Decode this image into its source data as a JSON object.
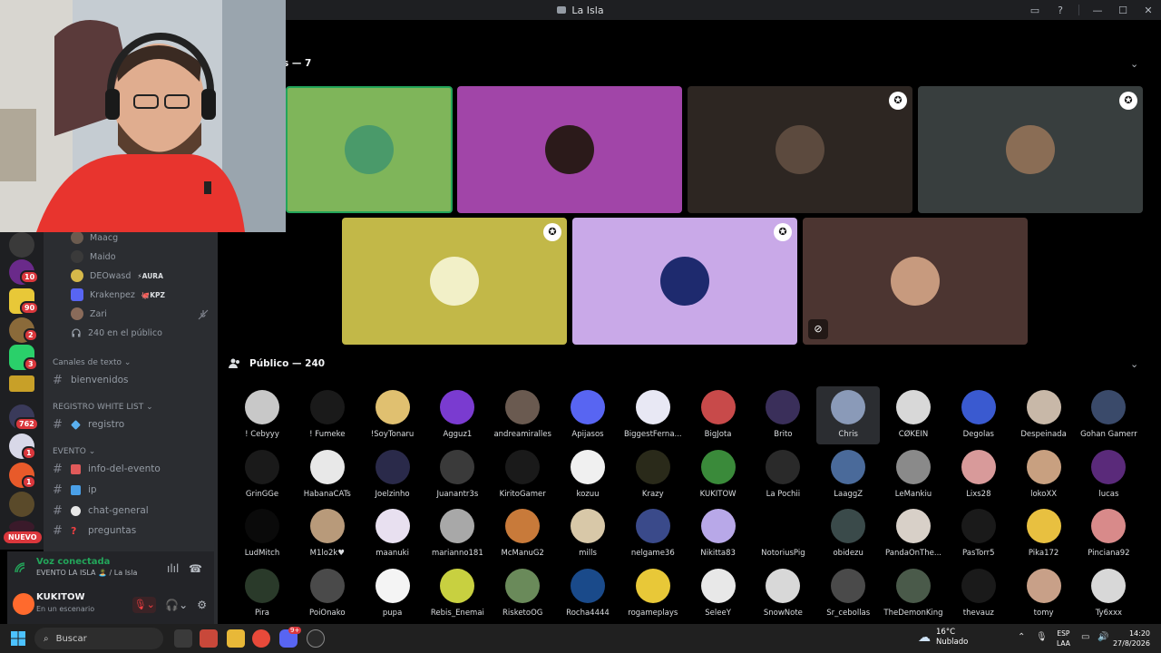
{
  "window": {
    "title": "La Isla",
    "buttons": [
      "▭",
      "?",
      "—",
      "☐",
      "✕"
    ]
  },
  "rail": {
    "badges": [
      "10",
      "90",
      "2",
      "3",
      "762",
      "1",
      "1"
    ],
    "new_label": "NUEVO"
  },
  "sidebar": {
    "voice_members": [
      {
        "name": "Maacg",
        "tag": "",
        "color": "#6b5b4f"
      },
      {
        "name": "Maido",
        "tag": "",
        "color": "#3a3a3a"
      },
      {
        "name": "DEOwasd",
        "tag": "⚡AURA",
        "color": "#d6b94a"
      },
      {
        "name": "Krakenpez",
        "tag": "🐙KPZ",
        "color": "#5865f2"
      },
      {
        "name": "Zari",
        "tag": "",
        "color": "#8a6b5a"
      }
    ],
    "audience_count": "240 en el público",
    "categories": {
      "text": "Canales de texto ⌄",
      "registro": "REGISTRO WHITE LIST ⌄",
      "evento": "EVENTO ⌄"
    },
    "channels": {
      "bienvenidos": "bienvenidos",
      "registro": "registro",
      "info": "info-del-evento",
      "ip": "ip",
      "chat": "chat-general",
      "preguntas": "preguntas"
    }
  },
  "voice_panel": {
    "status": "Voz conectada",
    "location": "EVENTO LA ISLA 🏝️ / La Isla",
    "username": "KUKITOW",
    "user_status": "En un escenario"
  },
  "stage": {
    "speakers_title": "s — 7",
    "audience_title": "Público — 240",
    "tiles": [
      {
        "bg": "#7fb55a",
        "av": "#4a9a6a",
        "star": false,
        "muted": false
      },
      {
        "bg": "#a145a8",
        "av": "#2b1a1a",
        "star": false,
        "muted": false
      },
      {
        "bg": "#2d2622",
        "av": "#5c4a3e",
        "star": true,
        "muted": false
      },
      {
        "bg": "#383e3e",
        "av": "#8a6d55",
        "star": true,
        "muted": false
      },
      {
        "bg": "#c2b848",
        "av": "#f2f0c8",
        "star": true,
        "muted": false
      },
      {
        "bg": "#c9a9e8",
        "av": "#1e2a6e",
        "star": true,
        "muted": false
      },
      {
        "bg": "#4c3531",
        "av": "#c79a7e",
        "star": false,
        "muted": true
      }
    ],
    "audience": [
      {
        "name": "! Cebyyy",
        "color": "#c8c8c8"
      },
      {
        "name": "! Fumeke",
        "color": "#1a1a1a"
      },
      {
        "name": "!SoyTonaru",
        "color": "#e0c070"
      },
      {
        "name": "Agguz1",
        "color": "#7a3bd0"
      },
      {
        "name": "andreamiralles",
        "color": "#6a5a50"
      },
      {
        "name": "Apijasos",
        "color": "#5865f2"
      },
      {
        "name": "BiggestFerna...",
        "color": "#e8e8f4"
      },
      {
        "name": "BigJota",
        "color": "#c84a4a"
      },
      {
        "name": "Brito",
        "color": "#3a2f5a"
      },
      {
        "name": "Chris",
        "color": "#8a9ab8"
      },
      {
        "name": "CØKEIN",
        "color": "#d8d8d8"
      },
      {
        "name": "Degolas",
        "color": "#3a5ad0"
      },
      {
        "name": "Despeinada",
        "color": "#c8b8a8"
      },
      {
        "name": "Gohan Gamerr",
        "color": "#3a4a6a"
      },
      {
        "name": "GrinGGe",
        "color": "#1a1a1a"
      },
      {
        "name": "HabanaCATs",
        "color": "#e8e8e8"
      },
      {
        "name": "Joelzinho",
        "color": "#2a2a4a"
      },
      {
        "name": "Juanantr3s",
        "color": "#3a3a3a"
      },
      {
        "name": "KiritoGamer",
        "color": "#1a1a1a"
      },
      {
        "name": "kozuu",
        "color": "#f0f0f0"
      },
      {
        "name": "Krazy",
        "color": "#2a2a1a"
      },
      {
        "name": "KUKITOW",
        "color": "#3a8a3a"
      },
      {
        "name": "La Pochii",
        "color": "#2a2a2a"
      },
      {
        "name": "LaaggZ",
        "color": "#4a6a9a"
      },
      {
        "name": "LeMankiu",
        "color": "#8a8a8a"
      },
      {
        "name": "Lixs28",
        "color": "#d89a9a"
      },
      {
        "name": "lokoXX",
        "color": "#c8a080"
      },
      {
        "name": "lucas",
        "color": "#5a2a7a"
      },
      {
        "name": "LudMitch",
        "color": "#0a0a0a"
      },
      {
        "name": "M1lo2k♥",
        "color": "#b89a7a"
      },
      {
        "name": "maanuki",
        "color": "#e8e0f0"
      },
      {
        "name": "marianno181",
        "color": "#a8a8a8"
      },
      {
        "name": "McManuG2",
        "color": "#c87a3a"
      },
      {
        "name": "mills",
        "color": "#d8c8a8"
      },
      {
        "name": "nelgame36",
        "color": "#3a4a8a"
      },
      {
        "name": "Nikitta83",
        "color": "#b8a8e8"
      },
      {
        "name": "NotoriusPig",
        "color": "#000000"
      },
      {
        "name": "obidezu",
        "color": "#3a4a4a"
      },
      {
        "name": "PandaOnThe...",
        "color": "#d8d0c8"
      },
      {
        "name": "PasTorr5",
        "color": "#1a1a1a"
      },
      {
        "name": "Pika172",
        "color": "#e8c040"
      },
      {
        "name": "Pinciana92",
        "color": "#d88a8a"
      },
      {
        "name": "Pira",
        "color": "#2a3a2a"
      },
      {
        "name": "PoiOnako",
        "color": "#4a4a4a"
      },
      {
        "name": "pupa",
        "color": "#f4f4f4"
      },
      {
        "name": "Rebis_Enemai",
        "color": "#c8d040"
      },
      {
        "name": "RisketoOG",
        "color": "#6a8a5a"
      },
      {
        "name": "Rocha4444",
        "color": "#1a4a8a"
      },
      {
        "name": "rogameplays",
        "color": "#e8c838"
      },
      {
        "name": "SeleeY",
        "color": "#e8e8e8"
      },
      {
        "name": "SnowNote",
        "color": "#d8d8d8"
      },
      {
        "name": "Sr_cebollas",
        "color": "#4a4a4a"
      },
      {
        "name": "TheDemonKing",
        "color": "#4a5a4a"
      },
      {
        "name": "thevauz",
        "color": "#1a1a1a"
      },
      {
        "name": "tomy",
        "color": "#c8a088"
      },
      {
        "name": "Ty6xxx",
        "color": "#d8d8d8"
      }
    ]
  },
  "taskbar": {
    "search_placeholder": "Buscar",
    "temp": "16°C",
    "weather": "Nublado",
    "lang_top": "ESP",
    "lang_bottom": "LAA",
    "time": "14:20",
    "date": "27/8/2026",
    "discord_badge": "9+"
  }
}
